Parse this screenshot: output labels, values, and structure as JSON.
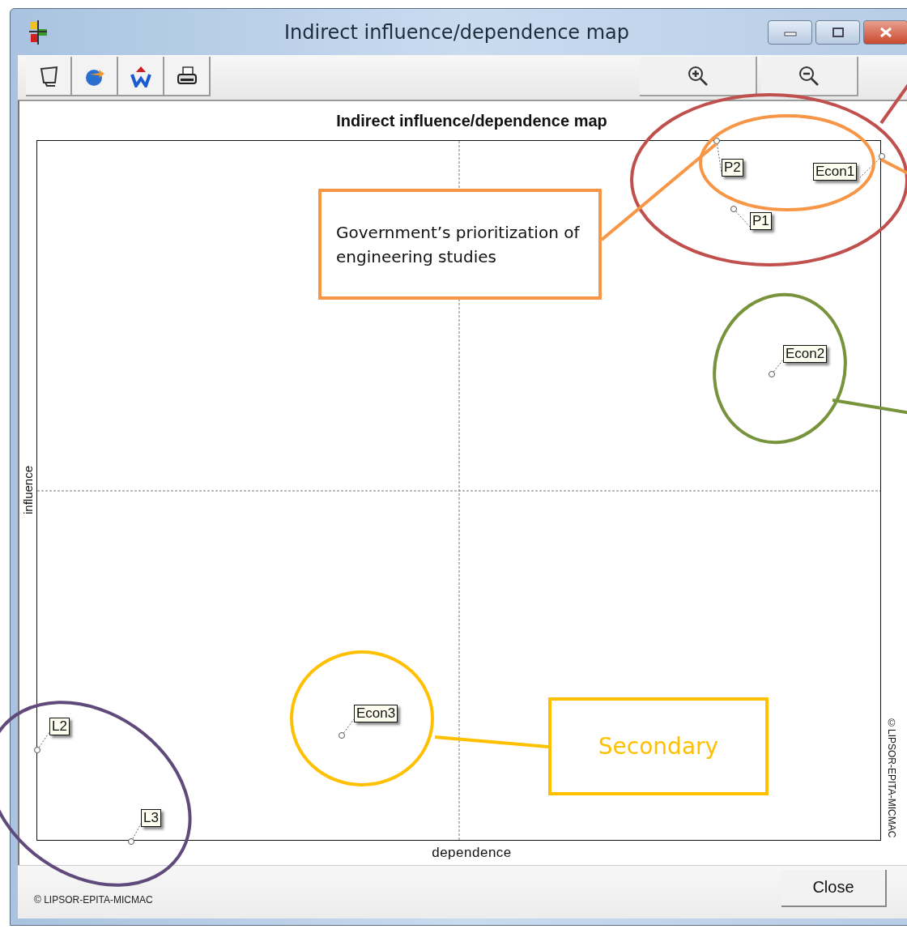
{
  "window": {
    "title": "Indirect influence/dependence map"
  },
  "chart": {
    "title": "Indirect influence/dependence map",
    "ylabel": "influence",
    "xlabel": "dependence",
    "side_credit": "©LIPSOR-EPITA-MICMAC",
    "points": [
      {
        "label": "P2"
      },
      {
        "label": "Econ1"
      },
      {
        "label": "P1"
      },
      {
        "label": "Econ2"
      },
      {
        "label": "Econ3"
      },
      {
        "label": "L2"
      },
      {
        "label": "L3"
      }
    ]
  },
  "highlights": [
    {
      "color": "#c0504d"
    },
    {
      "color": "#f79646"
    },
    {
      "color": "#77933c"
    },
    {
      "color": "#ffc000"
    },
    {
      "color": "#604a7b"
    }
  ],
  "annotations": [
    {
      "kind": "note",
      "text": "Government’s prioritization of engineering studies",
      "color": "#f79646"
    },
    {
      "kind": "label",
      "text": "Secondary",
      "color": "#ffc000"
    }
  ],
  "footer": {
    "credit": "© LIPSOR-EPITA-MICMAC",
    "close_button": "Close"
  }
}
